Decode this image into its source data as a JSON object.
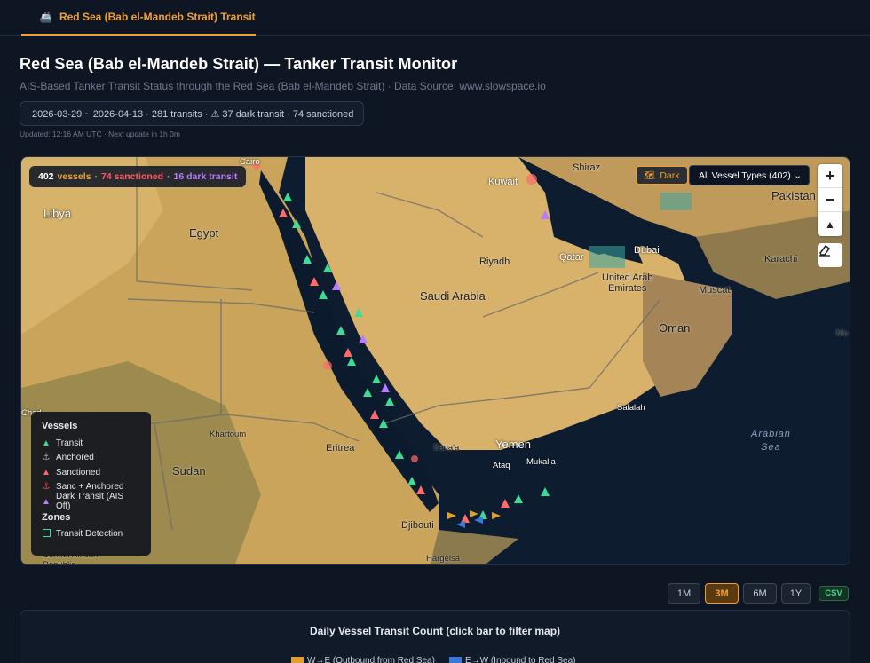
{
  "tab": {
    "icon": "ship-icon",
    "label": "Red Sea (Bab el-Mandeb Strait) Transit"
  },
  "header": {
    "title": "Red Sea (Bab el-Mandeb Strait) — Tanker Transit Monitor",
    "subtitle": "AIS-Based Tanker Transit Status through the Red Sea (Bab el-Mandeb Strait) · Data Source: www.slowspace.io",
    "summary": "2026-03-29 ~ 2026-04-13 · 281 transits · ⚠ 37 dark transit · 74 sanctioned",
    "updated": "Updated: 12:16 AM UTC · Next update in 1h 0m"
  },
  "map": {
    "stats": {
      "count": "402",
      "vessels": "vessels",
      "sanctioned": "74 sanctioned",
      "dark": "16 dark transit",
      "sep": "·"
    },
    "dark_toggle": {
      "icon": "map-icon",
      "label": "Dark"
    },
    "type_filter": {
      "value": "All Vessel Types (402)"
    },
    "zoom_in": "+",
    "zoom_out": "−",
    "compass": "▲",
    "labels": {
      "cairo": "Cairo",
      "libya": "Libya",
      "egypt": "Egypt",
      "kuwait": "Kuwait",
      "shiraz": "Shiraz",
      "pakistan": "Pakistan",
      "riyadh": "Riyadh",
      "qatar": "Qatar",
      "dubai": "Dubai",
      "karachi": "Karachi",
      "uae": "United Arab\nEmirates",
      "muscat": "Muscat",
      "saudi": "Saudi Arabia",
      "oman": "Oman",
      "mu": "Mu",
      "chad": "Chad",
      "khartoum": "Khartoum",
      "sudan": "Sudan",
      "eritrea": "Eritrea",
      "sanaa": "Sana'a",
      "yemen": "Yemen",
      "ataq": "Ataq",
      "mukalla": "Mukalla",
      "salalah": "Salalah",
      "arabian_sea": "Arabian\nSea",
      "djibouti": "Djibouti",
      "hargeisa": "Hargeisa",
      "car": "Central African\nRepublic"
    },
    "legend": {
      "vessels_title": "Vessels",
      "items": [
        {
          "icon": "transit-triangle-icon",
          "label": "Transit",
          "color": "#3ddc97"
        },
        {
          "icon": "anchor-icon",
          "label": "Anchored",
          "color": "#9aa3b5"
        },
        {
          "icon": "sanctioned-triangle-icon",
          "label": "Sanctioned",
          "color": "#ff6b6b"
        },
        {
          "icon": "red-anchor-icon",
          "label": "Sanc + Anchored",
          "color": "#ff4d4d"
        },
        {
          "icon": "dark-triangle-icon",
          "label": "Dark Transit (AIS Off)",
          "color": "#b57cff"
        }
      ],
      "zones_title": "Zones",
      "zone": "Transit Detection"
    }
  },
  "range": {
    "options": [
      "1M",
      "3M",
      "6M",
      "1Y"
    ],
    "selected": "3M",
    "csv": "CSV"
  },
  "chart": {
    "title": "Daily Vessel Transit Count (click bar to filter map)",
    "legend": [
      {
        "label": "W→E (Outbound from Red Sea)",
        "color": "#e0a030"
      },
      {
        "label": "E→W (Inbound to Red Sea)",
        "color": "#3a78d8"
      }
    ]
  }
}
